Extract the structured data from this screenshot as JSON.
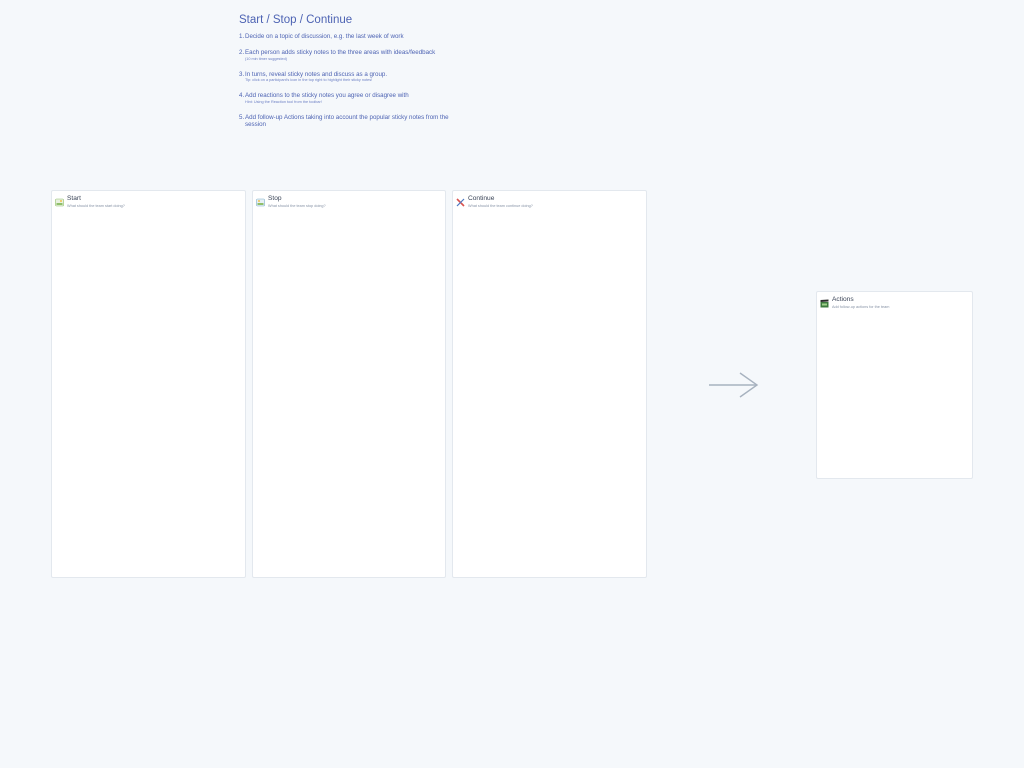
{
  "board": {
    "title": "Start / Stop / Continue",
    "steps": [
      {
        "num": "1.",
        "text": "Decide on a topic of discussion, e.g. the last week of work",
        "note": ""
      },
      {
        "num": "2.",
        "text": "Each person adds sticky notes to the three areas with ideas/feedback",
        "note": "(10 min timer suggested)"
      },
      {
        "num": "3.",
        "text": "In turns, reveal sticky notes and discuss as a group.",
        "note": "Tip: click on a participant's icon in the top right to highlight their sticky notes!"
      },
      {
        "num": "4.",
        "text": "Add reactions to the sticky notes you agree or disagree with",
        "note": "Hint: Using the Reaction tool from the toolbar!"
      },
      {
        "num": "5.",
        "text": "Add follow-up Actions taking into account the popular sticky notes from the session",
        "note": ""
      }
    ]
  },
  "columns": [
    {
      "name": "Start",
      "subtitle": "What should the team start doing?",
      "icon": "start-flag-icon",
      "icon_color": "#8fbf6a"
    },
    {
      "name": "Stop",
      "subtitle": "What should the team stop doing?",
      "icon": "stop-sign-icon",
      "icon_color": "#8fbf6a"
    },
    {
      "name": "Continue",
      "subtitle": "What should the team continue doing?",
      "icon": "continue-tools-icon",
      "icon_color": "#d9534f"
    },
    {
      "name": "Actions",
      "subtitle": "Add follow-up actions for the team",
      "icon": "actions-clapper-icon",
      "icon_color": "#3d7a3d"
    }
  ],
  "colors": {
    "background": "#f5f8fb",
    "text_accent": "#4d63b3",
    "arrow": "#a7b2bf"
  }
}
